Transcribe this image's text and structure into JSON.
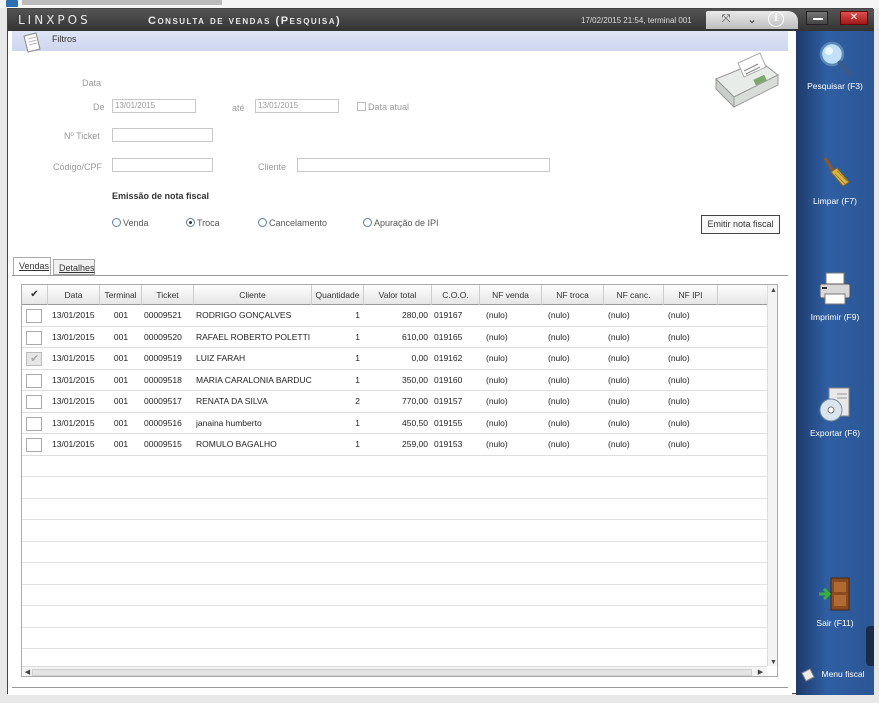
{
  "window": {
    "logo": "LINXPOS",
    "title": "Consulta de vendas (Pesquisa)",
    "status": "17/02/2015 21:54, terminal 001"
  },
  "filters": {
    "header": "Filtros",
    "data_label": "Data",
    "de_label": "De",
    "de_value": "13/01/2015",
    "ate_label": "até",
    "ate_value": "13/01/2015",
    "data_atual_label": "Data atual",
    "ticket_label": "Nº Ticket",
    "ticket_value": "",
    "cpf_label": "Código/CPF",
    "cpf_value": "",
    "cliente_label": "Cliente",
    "cliente_value": ""
  },
  "nota": {
    "title": "Emissão de nota fiscal",
    "options": [
      "Venda",
      "Troca",
      "Cancelamento",
      "Apuração de IPI"
    ],
    "selected": "Troca",
    "emit_button": "Emitir nota fiscal"
  },
  "tabs": [
    "Vendas",
    "Detalhes"
  ],
  "grid": {
    "check_header": "✔",
    "columns": [
      "Data",
      "Terminal",
      "Ticket",
      "Cliente",
      "Quantidade",
      "Valor total",
      "C.O.O.",
      "NF venda",
      "NF troca",
      "NF canc.",
      "NF IPI"
    ],
    "rows": [
      {
        "data": "13/01/2015",
        "terminal": "001",
        "ticket": "00009521",
        "cliente": "RODRIGO GONÇALVES",
        "quantidade": "1",
        "valor": "280,00",
        "coo": "019167",
        "nf_venda": "(nulo)",
        "nf_troca": "(nulo)",
        "nf_canc": "(nulo)",
        "nf_ipi": "(nulo)",
        "checked": false
      },
      {
        "data": "13/01/2015",
        "terminal": "001",
        "ticket": "00009520",
        "cliente": "RAFAEL ROBERTO POLETTI",
        "quantidade": "1",
        "valor": "610,00",
        "coo": "019165",
        "nf_venda": "(nulo)",
        "nf_troca": "(nulo)",
        "nf_canc": "(nulo)",
        "nf_ipi": "(nulo)",
        "checked": false
      },
      {
        "data": "13/01/2015",
        "terminal": "001",
        "ticket": "00009519",
        "cliente": "LUIZ FARAH",
        "quantidade": "1",
        "valor": "0,00",
        "coo": "019162",
        "nf_venda": "(nulo)",
        "nf_troca": "(nulo)",
        "nf_canc": "(nulo)",
        "nf_ipi": "(nulo)",
        "checked": true
      },
      {
        "data": "13/01/2015",
        "terminal": "001",
        "ticket": "00009518",
        "cliente": "MARIA CARALONIA BARDUCO",
        "quantidade": "1",
        "valor": "350,00",
        "coo": "019160",
        "nf_venda": "(nulo)",
        "nf_troca": "(nulo)",
        "nf_canc": "(nulo)",
        "nf_ipi": "(nulo)",
        "checked": false
      },
      {
        "data": "13/01/2015",
        "terminal": "001",
        "ticket": "00009517",
        "cliente": "RENATA DA SILVA",
        "quantidade": "2",
        "valor": "770,00",
        "coo": "019157",
        "nf_venda": "(nulo)",
        "nf_troca": "(nulo)",
        "nf_canc": "(nulo)",
        "nf_ipi": "(nulo)",
        "checked": false
      },
      {
        "data": "13/01/2015",
        "terminal": "001",
        "ticket": "00009516",
        "cliente": "janaina humberto",
        "quantidade": "1",
        "valor": "450,50",
        "coo": "019155",
        "nf_venda": "(nulo)",
        "nf_troca": "(nulo)",
        "nf_canc": "(nulo)",
        "nf_ipi": "(nulo)",
        "checked": false
      },
      {
        "data": "13/01/2015",
        "terminal": "001",
        "ticket": "00009515",
        "cliente": "ROMULO BAGALHO",
        "quantidade": "1",
        "valor": "259,00",
        "coo": "019153",
        "nf_venda": "(nulo)",
        "nf_troca": "(nulo)",
        "nf_canc": "(nulo)",
        "nf_ipi": "(nulo)",
        "checked": false
      }
    ]
  },
  "sidebar": {
    "items": [
      {
        "label": "Pesquisar (F3)",
        "icon": "magnifier-icon"
      },
      {
        "label": "Limpar (F7)",
        "icon": "broom-icon"
      },
      {
        "label": "Imprimir (F9)",
        "icon": "printer-icon"
      },
      {
        "label": "Exportar (F6)",
        "icon": "export-cd-icon"
      },
      {
        "label": "Sair (F11)",
        "icon": "exit-door-icon"
      }
    ],
    "menu_fiscal": "Menu fiscal"
  },
  "colors": {
    "sidebar": "#2f5fa3",
    "titlebar": "#444444",
    "filter_header": "#d6ddf2",
    "close": "#c02a2a"
  }
}
